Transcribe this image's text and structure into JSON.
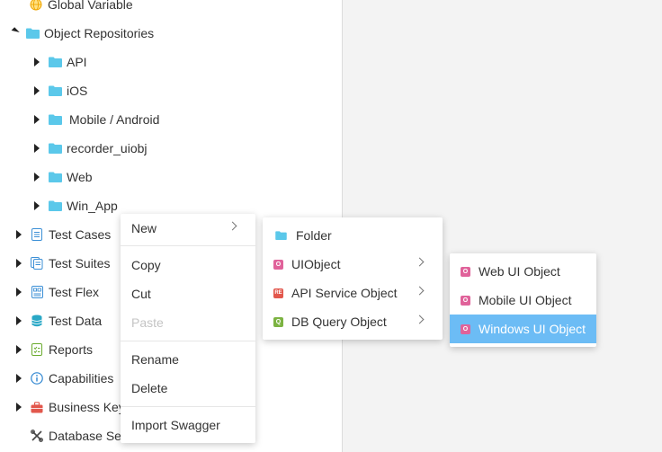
{
  "tree": {
    "global_variable": "Global Variable",
    "object_repositories": "Object Repositories",
    "children": [
      "API",
      "iOS",
      "Mobile / Android",
      "recorder_uiobj",
      "Web",
      "Win_App"
    ],
    "test_cases": "Test Cases",
    "test_suites": "Test Suites",
    "test_flex": "Test Flex",
    "test_data": "Test Data",
    "reports": "Reports",
    "capabilities": "Capabilities",
    "business_keywords": "Business Keyw",
    "database_settings": "Database Setti"
  },
  "context_menu": {
    "new": "New",
    "copy": "Copy",
    "cut": "Cut",
    "paste": "Paste",
    "rename": "Rename",
    "delete": "Delete",
    "import_swagger": "Import Swagger"
  },
  "new_submenu": {
    "folder": "Folder",
    "ui_object": "UIObject",
    "api_service_object": "API Service Object",
    "db_query_object": "DB Query Object",
    "badge_ui": "O",
    "badge_api": "RE",
    "badge_db": "Q"
  },
  "uiobject_submenu": {
    "web": "Web UI Object",
    "mobile": "Mobile UI Object",
    "windows": "Windows UI Object",
    "badge": "O"
  },
  "colors": {
    "folder": "#5bc8ea",
    "selected": "#6cbcf5",
    "badge_pink": "#e0629a",
    "badge_red": "#e2574c",
    "badge_green": "#7cb342"
  }
}
